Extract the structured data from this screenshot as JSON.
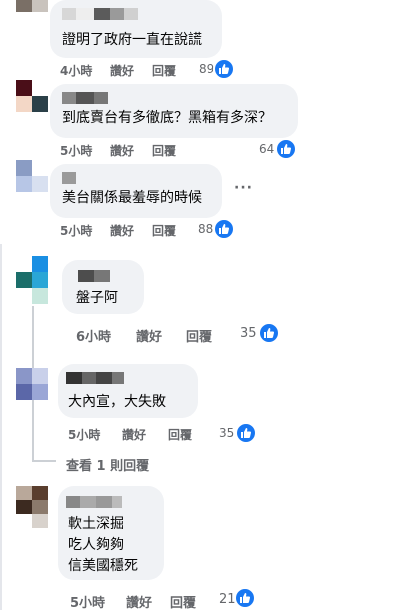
{
  "comments": [
    {
      "text": "證明了政府一直在說謊",
      "time": "4小時",
      "like_label": "讚好",
      "reply_label": "回覆",
      "likes": "89"
    },
    {
      "text": "到底賣台有多徹底？黑箱有多深？",
      "time": "5小時",
      "like_label": "讚好",
      "reply_label": "回覆",
      "likes": "64"
    },
    {
      "text": "美台關係最羞辱的時候",
      "time": "5小時",
      "like_label": "讚好",
      "reply_label": "回覆",
      "likes": "88",
      "more": "···"
    },
    {
      "text": "盤子阿",
      "time": "6小時",
      "like_label": "讚好",
      "reply_label": "回覆",
      "likes": "35"
    },
    {
      "text": "大內宣，大失敗",
      "time": "5小時",
      "like_label": "讚好",
      "reply_label": "回覆",
      "likes": "35",
      "view_replies": "查看 1 則回覆"
    },
    {
      "text": "軟土深掘\n吃人夠夠\n信美國穩死",
      "time": "5小時",
      "like_label": "讚好",
      "reply_label": "回覆",
      "likes": "21"
    }
  ],
  "colors": {
    "like_blue": "#1877f2",
    "meta_gray": "#65676b",
    "bubble_bg": "#f0f2f5"
  },
  "icons": {
    "like": "thumbs-up-icon"
  }
}
